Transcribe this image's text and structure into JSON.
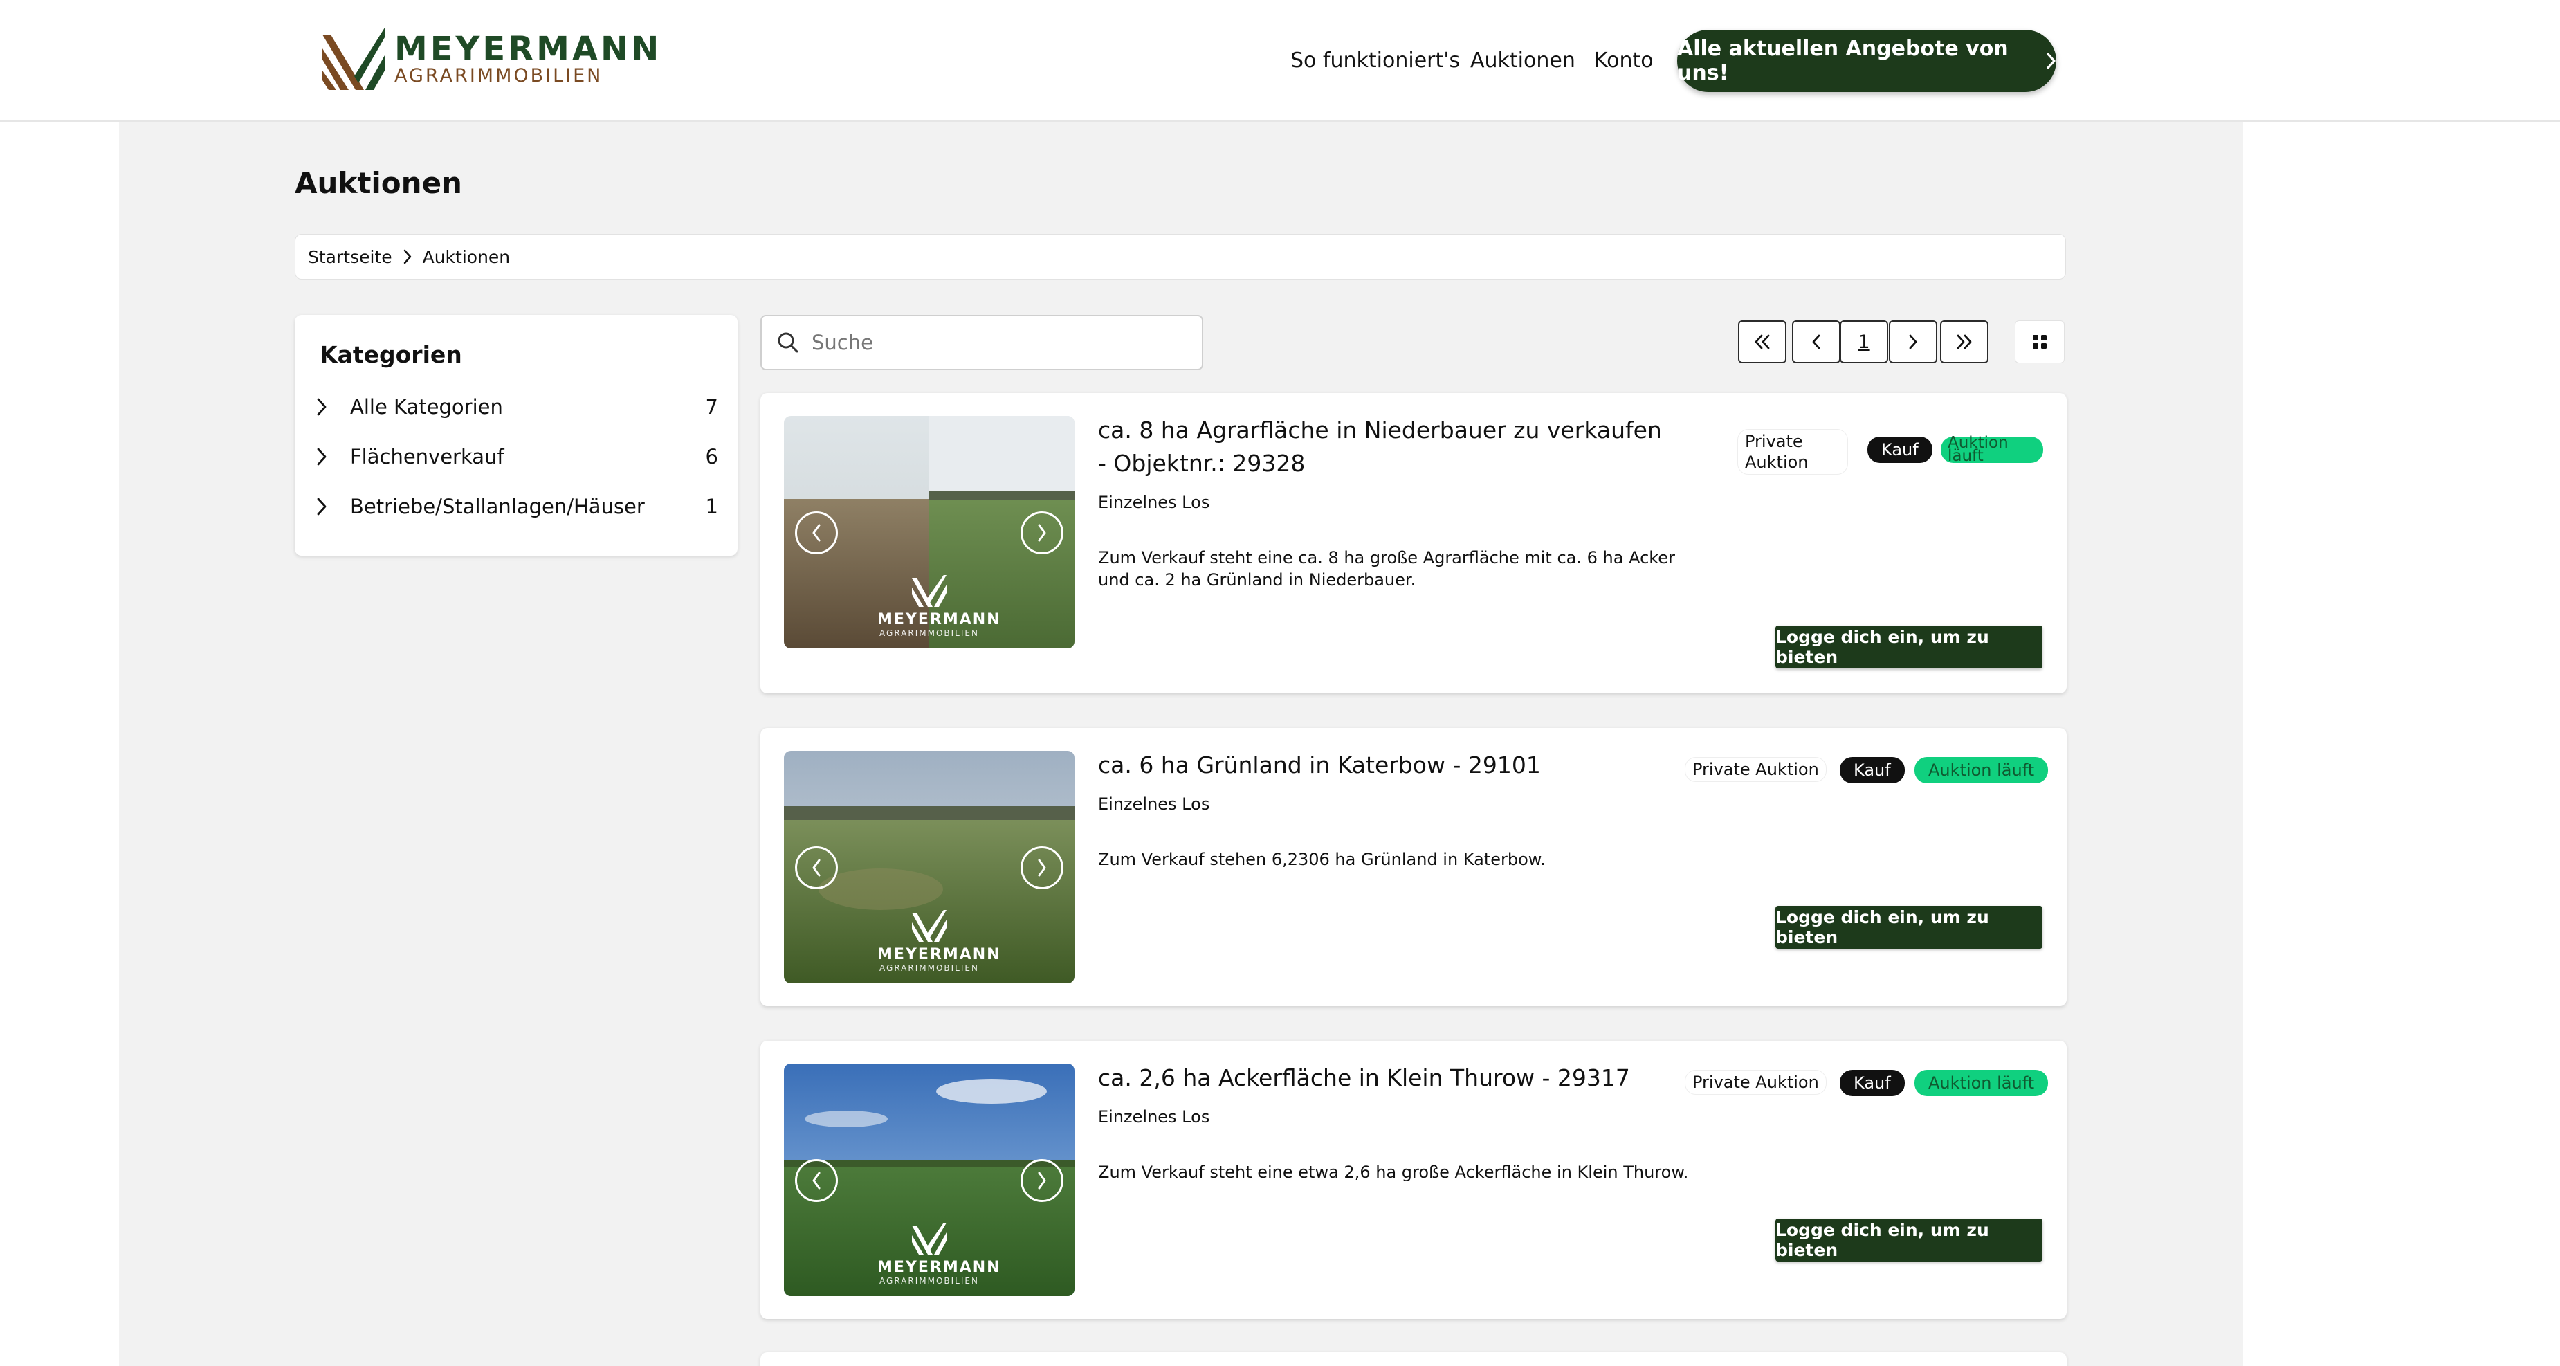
{
  "header": {
    "logo_title": "MEYERMANN",
    "logo_subtitle": "AGRARIMMOBILIEN",
    "nav": [
      {
        "label": "So funktioniert's"
      },
      {
        "label": "Auktionen"
      },
      {
        "label": "Konto"
      }
    ],
    "cta_label": "Alle aktuellen Angebote von uns!",
    "brand_color": "#1d3a1b"
  },
  "page": {
    "title": "Auktionen",
    "breadcrumb": [
      "Startseite",
      "Auktionen"
    ]
  },
  "sidebar": {
    "title": "Kategorien",
    "categories": [
      {
        "label": "Alle Kategorien",
        "count": "7"
      },
      {
        "label": "Flächenverkauf",
        "count": "6"
      },
      {
        "label": "Betriebe/Stallanlagen/Häuser",
        "count": "1"
      }
    ]
  },
  "search": {
    "placeholder": "Suche"
  },
  "pagination": {
    "first": "«",
    "prev": "‹",
    "current": "1",
    "next": "›",
    "last": "»"
  },
  "listings": [
    {
      "title": "ca. 8 ha Agrarfläche in Niederbauer zu verkaufen - Objektnr.: 29328",
      "lot": "Einzelnes Los",
      "description": "Zum Verkauf steht eine ca. 8 ha große Agrarfläche mit ca. 6 ha Acker und ca. 2 ha Grünland in Niederbauer.",
      "badge_private": "Private Auktion",
      "badge_type": "Kauf",
      "badge_status": "Auktion läuft",
      "bid_label": "Logge dich ein, um zu bieten",
      "watermark_name": "MEYERMANN",
      "watermark_sub": "AGRARIMMOBILIEN"
    },
    {
      "title": "ca. 6 ha Grünland in Katerbow - 29101",
      "lot": "Einzelnes Los",
      "description": "Zum Verkauf stehen 6,2306 ha Grünland in Katerbow.",
      "badge_private": "Private Auktion",
      "badge_type": "Kauf",
      "badge_status": "Auktion läuft",
      "bid_label": "Logge dich ein, um zu bieten",
      "watermark_name": "MEYERMANN",
      "watermark_sub": "AGRARIMMOBILIEN"
    },
    {
      "title": "ca. 2,6 ha Ackerfläche in Klein Thurow - 29317",
      "lot": "Einzelnes Los",
      "description": "Zum Verkauf steht eine etwa 2,6 ha große Ackerfläche in Klein Thurow.",
      "badge_private": "Private Auktion",
      "badge_type": "Kauf",
      "badge_status": "Auktion läuft",
      "bid_label": "Logge dich ein, um zu bieten",
      "watermark_name": "MEYERMANN",
      "watermark_sub": "AGRARIMMOBILIEN"
    }
  ]
}
